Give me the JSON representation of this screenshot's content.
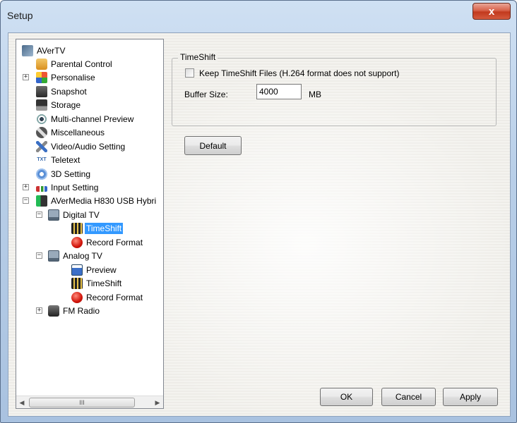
{
  "window": {
    "title": "Setup",
    "close_label": "x"
  },
  "tree": {
    "items": [
      {
        "label": "AVerTV",
        "icon": "avertv-app-icon"
      },
      {
        "label": "Parental Control",
        "icon": "lock-icon"
      },
      {
        "label": "Personalise",
        "icon": "personalise-icon"
      },
      {
        "label": "Snapshot",
        "icon": "camera-icon"
      },
      {
        "label": "Storage",
        "icon": "floppy-disk-icon"
      },
      {
        "label": "Multi-channel Preview",
        "icon": "eye-icon"
      },
      {
        "label": "Miscellaneous",
        "icon": "misc-icon"
      },
      {
        "label": "Video/Audio Setting",
        "icon": "tools-icon"
      },
      {
        "label": "Teletext",
        "icon": "teletext-icon"
      },
      {
        "label": "3D Setting",
        "icon": "gear-3d-icon"
      },
      {
        "label": "Input Setting",
        "icon": "input-icon"
      },
      {
        "label": "AVerMedia H830 USB Hybri",
        "icon": "tv-stick-icon"
      },
      {
        "label": "Digital TV",
        "icon": "digital-tv-icon"
      },
      {
        "label": "TimeShift",
        "icon": "film-timeshift-icon"
      },
      {
        "label": "Record Format",
        "icon": "record-icon"
      },
      {
        "label": "Analog TV",
        "icon": "analog-tv-icon"
      },
      {
        "label": "Preview",
        "icon": "preview-icon"
      },
      {
        "label": "TimeShift",
        "icon": "film-timeshift-icon"
      },
      {
        "label": "Record Format",
        "icon": "record-icon"
      },
      {
        "label": "FM Radio",
        "icon": "radio-icon"
      }
    ],
    "selected": "TimeShift",
    "scroll_thumb_glyph": "III"
  },
  "timeshift": {
    "group_title": "TimeShift",
    "keep_files_label": "Keep TimeShift Files (H.264 format does not support)",
    "keep_files_checked": false,
    "buffer_label": "Buffer Size:",
    "buffer_value": "4000",
    "buffer_unit": "MB"
  },
  "buttons": {
    "default": "Default",
    "ok": "OK",
    "cancel": "Cancel",
    "apply": "Apply"
  },
  "colors": {
    "selection": "#3399ff",
    "close_button": "#c2391e"
  }
}
